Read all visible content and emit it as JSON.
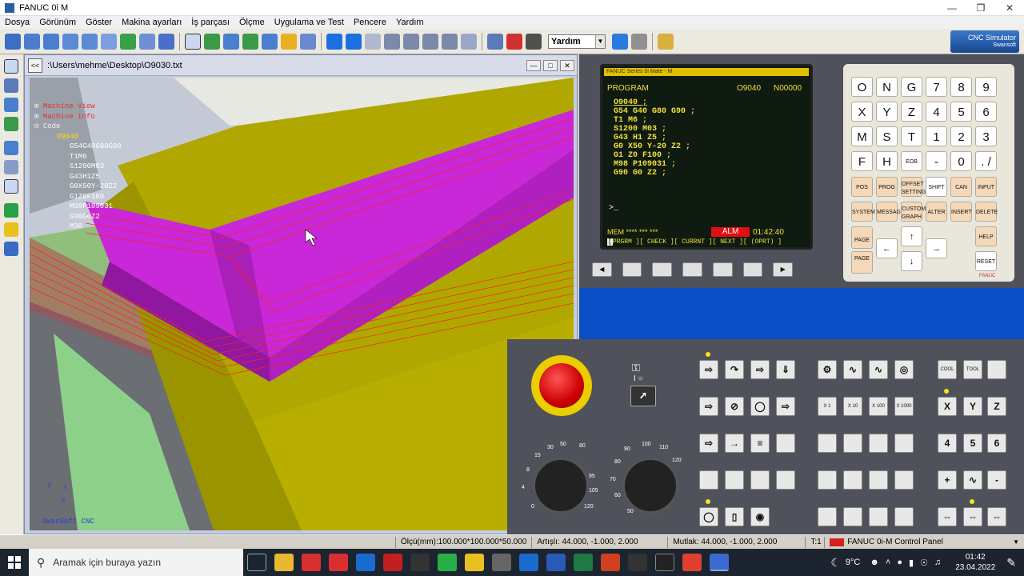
{
  "window": {
    "title": "FANUC 0i M"
  },
  "menu": [
    "Dosya",
    "Görünüm",
    "Göster",
    "Makina ayarları",
    "İş parçası",
    "Ölçme",
    "Uygulama ve Test",
    "Pencere",
    "Yardım"
  ],
  "toolbar": {
    "language": "Yardım"
  },
  "brand": {
    "name": "CNC Simulator",
    "sub": "Swansoft"
  },
  "viewer": {
    "path": ":\\Users\\mehme\\Desktop\\O9030.txt",
    "tree": {
      "machine_view": "Machine View",
      "machine_info": "Machine Info",
      "code": "Code",
      "program": "O9040",
      "lines": [
        "G54G40G80G90",
        "T1M6",
        "S1200M03",
        "G43H1Z5",
        "G0X50Y-20Z2",
        "G1Z0F100",
        "M98P109031",
        "G90G0Z2",
        "M30"
      ]
    },
    "axes": {
      "z": "Z",
      "y": "Y",
      "x": "X",
      "watermark": "SwanSoft CNC"
    }
  },
  "cnc_screen": {
    "header": "FANUC Series 0i Mate - M",
    "mode": "PROGRAM",
    "prog_no": "O9040",
    "seq_no": "N00000",
    "code": [
      "O9040 ;",
      "G54 G40 G80 G90 ;",
      "T1 M6 ;",
      "S1200 M03 ;",
      "G43 H1 Z5 ;",
      "G0 X50 Y-20 Z2 ;",
      "G1 Z0 F100 ;",
      "M98 P109031 ;",
      "G90 G0 Z2 ;"
    ],
    "prompt": ">_",
    "status": "MEM **** ***     ***",
    "alarm": "ALM",
    "time": "01:42:40",
    "softkeys": "PRGRM ][ CHECK ][ CURRNT ][ NEXT ][ (OPRT) ]"
  },
  "keypad": {
    "row1": [
      "O",
      "N",
      "G",
      "7",
      "8",
      "9"
    ],
    "row2": [
      "X",
      "Y",
      "Z",
      "4",
      "5",
      "6"
    ],
    "row3": [
      "M",
      "S",
      "T",
      "1",
      "2",
      "3"
    ],
    "row4": [
      "F",
      "H",
      "EOB",
      "-",
      "0",
      ". /"
    ],
    "row5": [
      "POS",
      "PROG",
      "OFFSET SETTING",
      "SHIFT",
      "CAN",
      "INPUT"
    ],
    "row6": [
      "SYSTEM",
      "MESSAGE",
      "CUSTOM GRAPH",
      "ALTER",
      "INSERT",
      "DELETE"
    ],
    "page_up": "PAGE",
    "page_down": "PAGE",
    "help": "HELP",
    "reset": "RESET",
    "maker": "FANUC"
  },
  "operator": {
    "feed_scale": [
      "0",
      "2",
      "4",
      "6",
      "8",
      "10",
      "15",
      "20",
      "30",
      "40",
      "50",
      "60",
      "70",
      "80",
      "90",
      "95",
      "100",
      "105",
      "110",
      "120"
    ],
    "spindle_scale": [
      "50",
      "60",
      "70",
      "80",
      "90",
      "100",
      "110",
      "120"
    ],
    "jog": [
      "X 1",
      "X 10",
      "X 100",
      "X 1000"
    ],
    "axis_btns": [
      "X",
      "Y",
      "Z",
      "4",
      "5",
      "6",
      "+",
      "-"
    ],
    "coolant": "COOL",
    "tool": "TOOL"
  },
  "statusbar": {
    "scale": "Ölçü(mm):100.000*100.000*50.000",
    "incremental": "Artışlı:  44.000,  -1.000,  2.000",
    "absolute": "Mutlak:  44.000,  -1.000,  2.000",
    "t": "T:1",
    "panel": "FANUC 0i-M Control Panel"
  },
  "taskbar": {
    "search": "Aramak için buraya yazın",
    "temp": "9°C",
    "time": "01:42",
    "date": "23.04.2022"
  }
}
